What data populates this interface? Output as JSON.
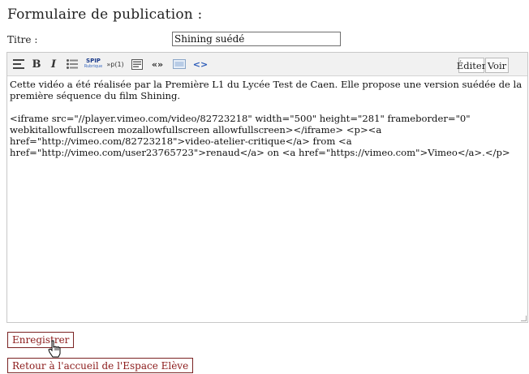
{
  "page": {
    "title": "Formulaire de publication :"
  },
  "form": {
    "titre_label": "Titre :",
    "titre_value": "Shining suédé"
  },
  "toolbar": {
    "bold": "B",
    "italic": "I",
    "spip_top": "SPIP",
    "spip_bottom": "Rubrique",
    "note": "»p(1)",
    "quote": "«»",
    "code": "<>",
    "edit_tab": "Éditer",
    "view_tab": "Voir"
  },
  "editor": {
    "text": "Cette vidéo a été réalisée par la Première L1 du Lycée Test de Caen. Elle propose une version suédée de la première séquence du film Shining.\n\n<iframe src=\"//player.vimeo.com/video/82723218\" width=\"500\" height=\"281\" frameborder=\"0\" webkitallowfullscreen mozallowfullscreen allowfullscreen></iframe> <p><a href=\"http://vimeo.com/82723218\">video-atelier-critique</a> from <a href=\"http://vimeo.com/user23765723\">renaud</a> on <a href=\"https://vimeo.com\">Vimeo</a>.</p>"
  },
  "actions": {
    "save_label": "Enregistrer",
    "back_label": "Retour à l'accueil de l'Espace Elève"
  }
}
